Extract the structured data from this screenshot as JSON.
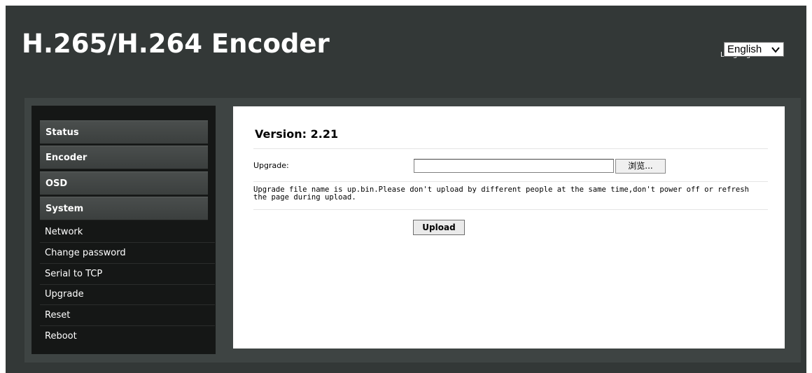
{
  "header": {
    "title": "H.265/H.264 Encoder",
    "language_label": "Language:",
    "language_selected": "English"
  },
  "sidebar": {
    "sections": [
      {
        "label": "Status"
      },
      {
        "label": "Encoder"
      },
      {
        "label": "OSD"
      },
      {
        "label": "System"
      }
    ],
    "system_items": [
      {
        "label": "Network"
      },
      {
        "label": "Change password"
      },
      {
        "label": "Serial to TCP"
      },
      {
        "label": "Upgrade"
      },
      {
        "label": "Reset"
      },
      {
        "label": "Reboot"
      }
    ]
  },
  "main": {
    "version": "Version: 2.21",
    "upgrade_label": "Upgrade:",
    "browse_label": "浏览...",
    "file_value": "",
    "note": "Upgrade file name is up.bin.Please don't upload by different people at the same time,don't power off or refresh the page during upload.",
    "upload_label": "Upload"
  },
  "colors": {
    "background_dark": "#333837",
    "sidebar": "#151716",
    "panel": "#ffffff"
  }
}
